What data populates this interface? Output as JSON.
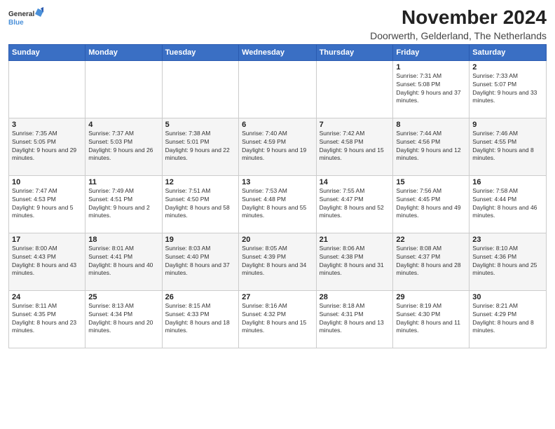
{
  "logo": {
    "line1": "General",
    "line2": "Blue"
  },
  "title": "November 2024",
  "location": "Doorwerth, Gelderland, The Netherlands",
  "days_of_week": [
    "Sunday",
    "Monday",
    "Tuesday",
    "Wednesday",
    "Thursday",
    "Friday",
    "Saturday"
  ],
  "weeks": [
    [
      {
        "day": "",
        "info": ""
      },
      {
        "day": "",
        "info": ""
      },
      {
        "day": "",
        "info": ""
      },
      {
        "day": "",
        "info": ""
      },
      {
        "day": "",
        "info": ""
      },
      {
        "day": "1",
        "info": "Sunrise: 7:31 AM\nSunset: 5:08 PM\nDaylight: 9 hours and 37 minutes."
      },
      {
        "day": "2",
        "info": "Sunrise: 7:33 AM\nSunset: 5:07 PM\nDaylight: 9 hours and 33 minutes."
      }
    ],
    [
      {
        "day": "3",
        "info": "Sunrise: 7:35 AM\nSunset: 5:05 PM\nDaylight: 9 hours and 29 minutes."
      },
      {
        "day": "4",
        "info": "Sunrise: 7:37 AM\nSunset: 5:03 PM\nDaylight: 9 hours and 26 minutes."
      },
      {
        "day": "5",
        "info": "Sunrise: 7:38 AM\nSunset: 5:01 PM\nDaylight: 9 hours and 22 minutes."
      },
      {
        "day": "6",
        "info": "Sunrise: 7:40 AM\nSunset: 4:59 PM\nDaylight: 9 hours and 19 minutes."
      },
      {
        "day": "7",
        "info": "Sunrise: 7:42 AM\nSunset: 4:58 PM\nDaylight: 9 hours and 15 minutes."
      },
      {
        "day": "8",
        "info": "Sunrise: 7:44 AM\nSunset: 4:56 PM\nDaylight: 9 hours and 12 minutes."
      },
      {
        "day": "9",
        "info": "Sunrise: 7:46 AM\nSunset: 4:55 PM\nDaylight: 9 hours and 8 minutes."
      }
    ],
    [
      {
        "day": "10",
        "info": "Sunrise: 7:47 AM\nSunset: 4:53 PM\nDaylight: 9 hours and 5 minutes."
      },
      {
        "day": "11",
        "info": "Sunrise: 7:49 AM\nSunset: 4:51 PM\nDaylight: 9 hours and 2 minutes."
      },
      {
        "day": "12",
        "info": "Sunrise: 7:51 AM\nSunset: 4:50 PM\nDaylight: 8 hours and 58 minutes."
      },
      {
        "day": "13",
        "info": "Sunrise: 7:53 AM\nSunset: 4:48 PM\nDaylight: 8 hours and 55 minutes."
      },
      {
        "day": "14",
        "info": "Sunrise: 7:55 AM\nSunset: 4:47 PM\nDaylight: 8 hours and 52 minutes."
      },
      {
        "day": "15",
        "info": "Sunrise: 7:56 AM\nSunset: 4:45 PM\nDaylight: 8 hours and 49 minutes."
      },
      {
        "day": "16",
        "info": "Sunrise: 7:58 AM\nSunset: 4:44 PM\nDaylight: 8 hours and 46 minutes."
      }
    ],
    [
      {
        "day": "17",
        "info": "Sunrise: 8:00 AM\nSunset: 4:43 PM\nDaylight: 8 hours and 43 minutes."
      },
      {
        "day": "18",
        "info": "Sunrise: 8:01 AM\nSunset: 4:41 PM\nDaylight: 8 hours and 40 minutes."
      },
      {
        "day": "19",
        "info": "Sunrise: 8:03 AM\nSunset: 4:40 PM\nDaylight: 8 hours and 37 minutes."
      },
      {
        "day": "20",
        "info": "Sunrise: 8:05 AM\nSunset: 4:39 PM\nDaylight: 8 hours and 34 minutes."
      },
      {
        "day": "21",
        "info": "Sunrise: 8:06 AM\nSunset: 4:38 PM\nDaylight: 8 hours and 31 minutes."
      },
      {
        "day": "22",
        "info": "Sunrise: 8:08 AM\nSunset: 4:37 PM\nDaylight: 8 hours and 28 minutes."
      },
      {
        "day": "23",
        "info": "Sunrise: 8:10 AM\nSunset: 4:36 PM\nDaylight: 8 hours and 25 minutes."
      }
    ],
    [
      {
        "day": "24",
        "info": "Sunrise: 8:11 AM\nSunset: 4:35 PM\nDaylight: 8 hours and 23 minutes."
      },
      {
        "day": "25",
        "info": "Sunrise: 8:13 AM\nSunset: 4:34 PM\nDaylight: 8 hours and 20 minutes."
      },
      {
        "day": "26",
        "info": "Sunrise: 8:15 AM\nSunset: 4:33 PM\nDaylight: 8 hours and 18 minutes."
      },
      {
        "day": "27",
        "info": "Sunrise: 8:16 AM\nSunset: 4:32 PM\nDaylight: 8 hours and 15 minutes."
      },
      {
        "day": "28",
        "info": "Sunrise: 8:18 AM\nSunset: 4:31 PM\nDaylight: 8 hours and 13 minutes."
      },
      {
        "day": "29",
        "info": "Sunrise: 8:19 AM\nSunset: 4:30 PM\nDaylight: 8 hours and 11 minutes."
      },
      {
        "day": "30",
        "info": "Sunrise: 8:21 AM\nSunset: 4:29 PM\nDaylight: 8 hours and 8 minutes."
      }
    ]
  ]
}
